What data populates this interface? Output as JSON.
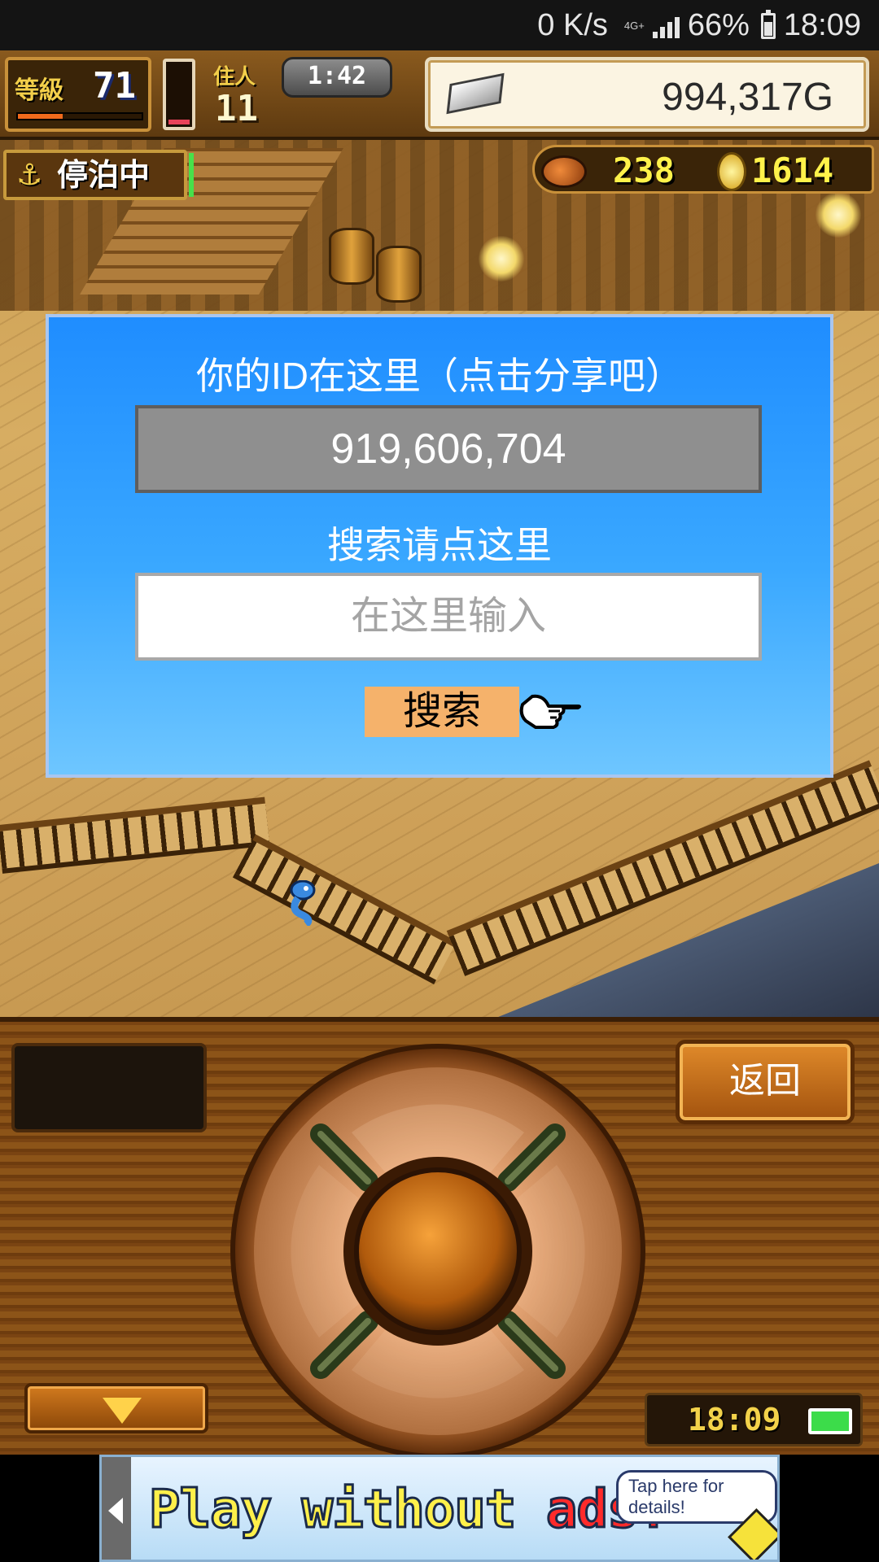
{
  "status_bar": {
    "net_speed": "0 K/s",
    "network_type": "4G+",
    "battery_percent": "66%",
    "time": "18:09"
  },
  "hud": {
    "level_label": "等級",
    "level_value": "71",
    "level_progress": 0.36,
    "stamina_level": 0.08,
    "population_label": "住人",
    "population_value": "11",
    "timer": "1:42",
    "gold": "994,317G",
    "status_label": "停泊中",
    "food": "238",
    "medals": "1614"
  },
  "dialog": {
    "title": "你的ID在这里（点击分享吧）",
    "player_id": "919,606,704",
    "search_label": "搜索请点这里",
    "search_placeholder": "在这里输入",
    "search_button": "搜索"
  },
  "controller": {
    "back_button": "返回",
    "clock": "18:09"
  },
  "ad": {
    "headline_part1": "Play without ",
    "headline_part2": "ads!",
    "tap_text": "Tap here for details!"
  },
  "colors": {
    "dialog_top": "#1f8dff",
    "dialog_bottom": "#6ec6ff",
    "id_box": "#8f8f8f",
    "search_button": "#f5b26b",
    "hud_yellow": "#fff24a",
    "wood": "#7a4412"
  },
  "icons": {
    "anchor": "anchor-icon",
    "silver": "silver-ingot-icon",
    "meat": "meat-icon",
    "coin": "medal-coin-icon",
    "hand": "pointing-hand-icon",
    "battery": "battery-icon"
  }
}
